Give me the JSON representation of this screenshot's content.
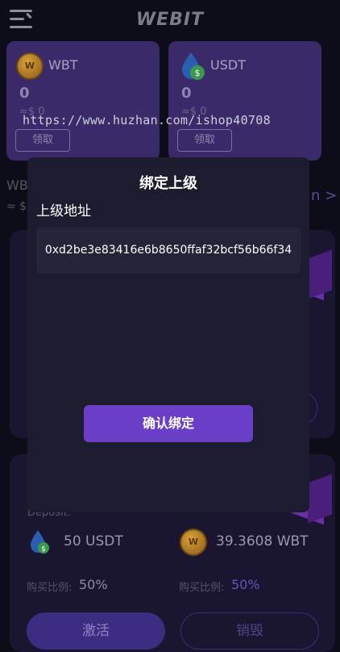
{
  "header": {
    "logo": "WEBIT"
  },
  "tokens": [
    {
      "name": "WBT",
      "amount": "0",
      "approx": "≈$ 0",
      "action_label": "领取",
      "icon": "wbt-coin-icon"
    },
    {
      "name": "USDT",
      "amount": "0",
      "approx": "≈$ 0",
      "action_label": "领取",
      "icon": "usdt-drop-icon"
    }
  ],
  "watermark": "https://www.huzhan.com/ishop40708",
  "background": {
    "side_label": "WB",
    "side_approx": "≈ $",
    "side_chevron": "n >",
    "deposit_label": "Deposit:",
    "deposit_usdt": "50 USDT",
    "deposit_wbt": "39.3608 WBT",
    "ratio_label": "购买比例:",
    "ratio_left": "50%",
    "ratio_right": "50%",
    "activate_label": "激活",
    "destroy_label": "销毁"
  },
  "modal": {
    "title": "绑定上级",
    "field_label": "上级地址",
    "address_value": "0xd2be3e83416e6b8650ffaf32bcf56b66f34",
    "confirm_label": "确认绑定"
  },
  "colors": {
    "accent": "#6a3ec6",
    "modal_bg": "#1b1c2e",
    "page_bg": "#0d0d17"
  }
}
